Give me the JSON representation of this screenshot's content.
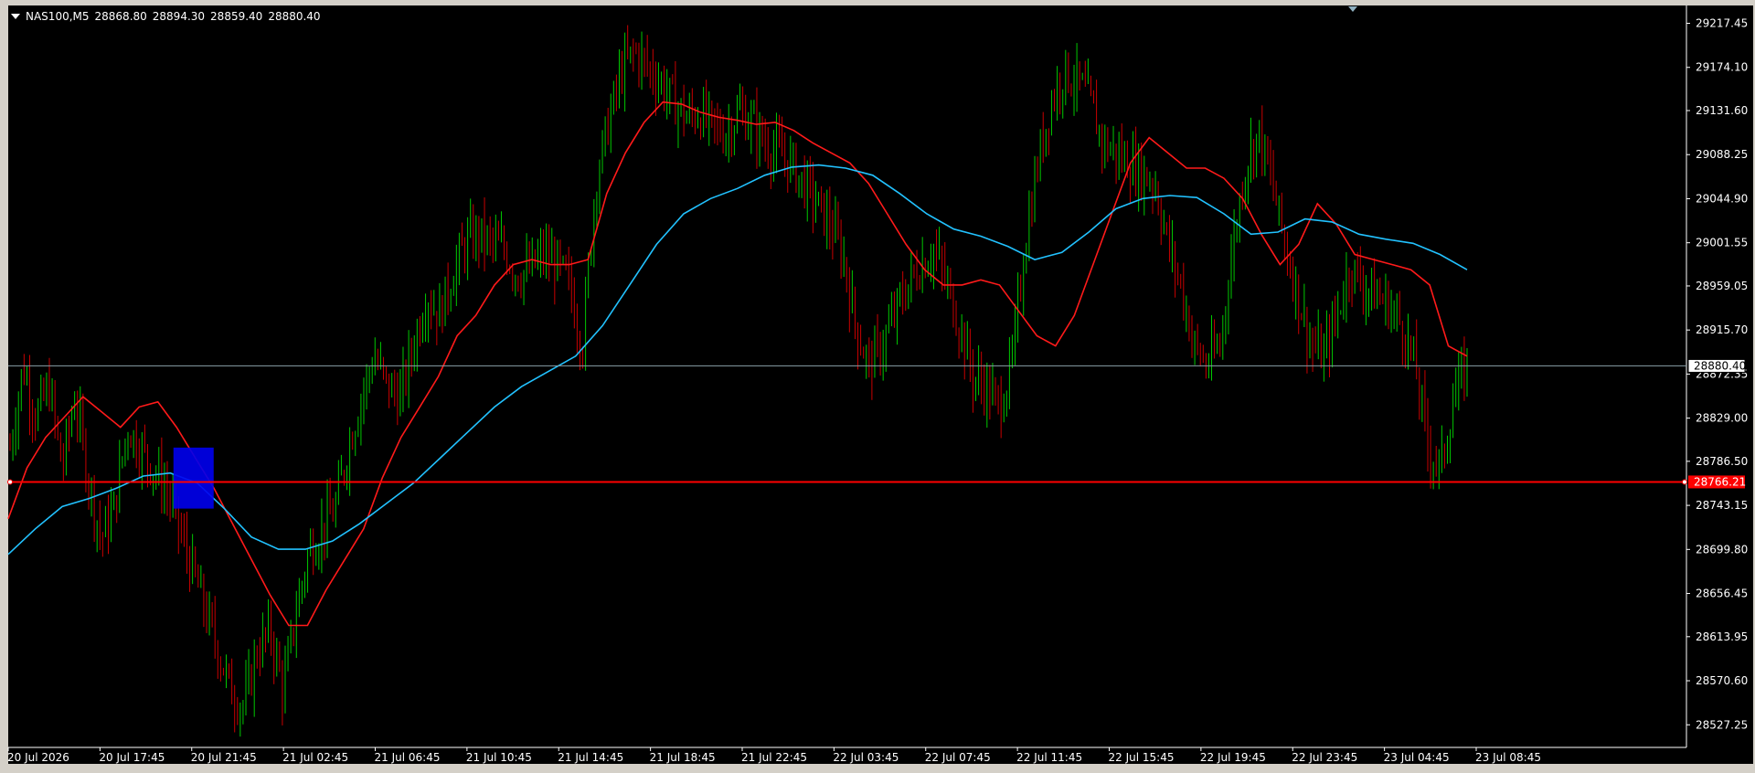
{
  "header": {
    "symbol": "NAS100,M5",
    "open": "28868.80",
    "high": "28894.30",
    "low": "28859.40",
    "close": "28880.40"
  },
  "colors": {
    "background": "#000000",
    "candle_bull": "#00c800",
    "candle_bear": "#c80000",
    "ma_fast": "#ff1a1a",
    "ma_slow": "#22c2ff",
    "price_line": "#8aa0a8",
    "hline": "#ff0000",
    "zone": "#0000ee",
    "axis_text": "#ffffff"
  },
  "chart_data": {
    "type": "line",
    "title": "NAS100,M5",
    "ylim": [
      28505,
      29235
    ],
    "y_ticks": [
      "29217.45",
      "29174.10",
      "29131.60",
      "29088.25",
      "29044.90",
      "29001.55",
      "28959.05",
      "28915.70",
      "28872.35",
      "28829.00",
      "28786.50",
      "28743.15",
      "28699.80",
      "28656.45",
      "28613.95",
      "28570.60",
      "28527.25"
    ],
    "x_ticks": [
      "20 Jul 2026",
      "20 Jul 17:45",
      "20 Jul 21:45",
      "21 Jul 02:45",
      "21 Jul 06:45",
      "21 Jul 10:45",
      "21 Jul 14:45",
      "21 Jul 18:45",
      "21 Jul 22:45",
      "22 Jul 03:45",
      "22 Jul 07:45",
      "22 Jul 11:45",
      "22 Jul 15:45",
      "22 Jul 19:45",
      "22 Jul 23:45",
      "23 Jul 04:45",
      "23 Jul 08:45"
    ],
    "price_path": [
      28800,
      28880,
      28830,
      28860,
      28780,
      28850,
      28770,
      28710,
      28740,
      28820,
      28800,
      28780,
      28760,
      28720,
      28680,
      28640,
      28600,
      28560,
      28545,
      28600,
      28620,
      28560,
      28640,
      28700,
      28720,
      28740,
      28800,
      28850,
      28890,
      28860,
      28850,
      28900,
      28950,
      28930,
      28970,
      29000,
      29010,
      29000,
      28995,
      28970,
      28975,
      28990,
      28980,
      28960,
      28900,
      29060,
      29120,
      29170,
      29190,
      29175,
      29160,
      29140,
      29125,
      29130,
      29115,
      29110,
      29130,
      29120,
      29100,
      29090,
      29080,
      29060,
      29040,
      29020,
      28990,
      28920,
      28880,
      28900,
      28930,
      28960,
      28980,
      28995,
      28960,
      28920,
      28870,
      28860,
      28840,
      28880,
      29000,
      29080,
      29140,
      29170,
      29160,
      29140,
      29100,
      29090,
      29080,
      29070,
      29060,
      29000,
      28960,
      28900,
      28880,
      28900,
      29000,
      29080,
      29110,
      29060,
      29000,
      28950,
      28900,
      28890,
      28930,
      28980,
      28960,
      28950,
      28940,
      28920,
      28880,
      28800,
      28780,
      28850,
      28880
    ],
    "series": [
      {
        "name": "",
        "color": "#ff1a1a",
        "values": [
          28730,
          28780,
          28810,
          28830,
          28850,
          28835,
          28820,
          28840,
          28845,
          28820,
          28790,
          28760,
          28725,
          28690,
          28655,
          28625,
          28625,
          28660,
          28690,
          28720,
          28770,
          28810,
          28840,
          28870,
          28910,
          28930,
          28960,
          28980,
          28985,
          28980,
          28980,
          28985,
          29050,
          29090,
          29120,
          29140,
          29138,
          29130,
          29125,
          29122,
          29118,
          29120,
          29112,
          29100,
          29090,
          29080,
          29060,
          29030,
          29000,
          28975,
          28960,
          28960,
          28965,
          28960,
          28935,
          28910,
          28900,
          28930,
          28980,
          29030,
          29080,
          29105,
          29090,
          29075,
          29075,
          29065,
          29045,
          29010,
          28980,
          29000,
          29040,
          29020,
          28990,
          28985,
          28980,
          28975,
          28960,
          28900,
          28890
        ]
      },
      {
        "name": "",
        "color": "#22c2ff",
        "values": [
          28695,
          28720,
          28742,
          28750,
          28760,
          28772,
          28775,
          28765,
          28740,
          28712,
          28700,
          28700,
          28708,
          28725,
          28745,
          28765,
          28790,
          28815,
          28840,
          28860,
          28875,
          28890,
          28920,
          28960,
          29000,
          29030,
          29045,
          29055,
          29068,
          29076,
          29078,
          29075,
          29068,
          29050,
          29030,
          29015,
          29008,
          28998,
          28985,
          28992,
          29012,
          29035,
          29045,
          29048,
          29046,
          29030,
          29010,
          29012,
          29025,
          29022,
          29010,
          29005,
          29001,
          28990,
          28975
        ]
      }
    ],
    "hlines": [
      {
        "value": 28880.4,
        "label": "28880.40",
        "kind": "current_price"
      },
      {
        "value": 28766.21,
        "label": "28766.21",
        "kind": "horizontal_level"
      }
    ],
    "zone": {
      "x_start": "20 Jul 21:45",
      "y_top": 28800,
      "y_bottom": 28740
    },
    "grid": false
  }
}
